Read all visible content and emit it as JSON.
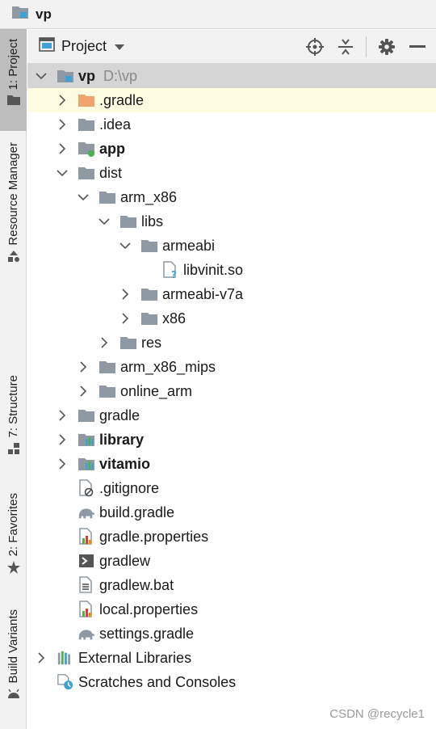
{
  "breadcrumb": {
    "title": "vp",
    "icon": "project-folder-icon"
  },
  "left_strip": {
    "tabs": [
      {
        "label": "1: Project",
        "icon": "folder-icon"
      },
      {
        "label": "Resource Manager",
        "icon": "shapes-icon"
      },
      {
        "label": "7: Structure",
        "icon": "structure-icon"
      },
      {
        "label": "2: Favorites",
        "icon": "star-icon"
      },
      {
        "label": "Build Variants",
        "icon": "android-icon"
      }
    ]
  },
  "panel_header": {
    "view_label": "Project",
    "tools": [
      "locate-icon",
      "collapse-all-icon",
      "gear-icon",
      "minimize-icon"
    ]
  },
  "tree": [
    {
      "label": "vp",
      "hint": "D:\\vp",
      "bold": true,
      "expanded": true,
      "icon": "module-folder-icon"
    },
    {
      "label": ".gradle",
      "icon": "orange-folder-icon",
      "expanded": false
    },
    {
      "label": ".idea",
      "icon": "folder-icon",
      "expanded": false
    },
    {
      "label": "app",
      "bold": true,
      "icon": "android-module-icon",
      "expanded": false
    },
    {
      "label": "dist",
      "icon": "folder-icon",
      "expanded": true
    },
    {
      "label": "arm_x86",
      "icon": "folder-icon",
      "expanded": true
    },
    {
      "label": "libs",
      "icon": "folder-icon",
      "expanded": true
    },
    {
      "label": "armeabi",
      "icon": "folder-icon",
      "expanded": true
    },
    {
      "label": "libvinit.so",
      "icon": "unknown-file-icon"
    },
    {
      "label": "armeabi-v7a",
      "icon": "folder-icon",
      "expanded": false
    },
    {
      "label": "x86",
      "icon": "folder-icon",
      "expanded": false
    },
    {
      "label": "res",
      "icon": "folder-icon",
      "expanded": false
    },
    {
      "label": "arm_x86_mips",
      "icon": "folder-icon",
      "expanded": false
    },
    {
      "label": "online_arm",
      "icon": "folder-icon",
      "expanded": false
    },
    {
      "label": "gradle",
      "icon": "folder-icon",
      "expanded": false
    },
    {
      "label": "library",
      "bold": true,
      "icon": "library-module-icon",
      "expanded": false
    },
    {
      "label": "vitamio",
      "bold": true,
      "icon": "library-module-icon",
      "expanded": false
    },
    {
      "label": ".gitignore",
      "icon": "gitignore-file-icon"
    },
    {
      "label": "build.gradle",
      "icon": "gradle-elephant-icon"
    },
    {
      "label": "gradle.properties",
      "icon": "properties-file-icon"
    },
    {
      "label": "gradlew",
      "icon": "shell-script-icon"
    },
    {
      "label": "gradlew.bat",
      "icon": "text-file-icon"
    },
    {
      "label": "local.properties",
      "icon": "properties-file-icon"
    },
    {
      "label": "settings.gradle",
      "icon": "gradle-elephant-icon"
    },
    {
      "label": "External Libraries",
      "icon": "external-libraries-icon",
      "expanded": false
    },
    {
      "label": "Scratches and Consoles",
      "icon": "scratches-icon"
    }
  ],
  "watermark": "CSDN @recycle1",
  "colors": {
    "selected_row": "#d5d5d5",
    "highlight_row": "#fdfbe0",
    "folder": "#8e99a3",
    "accent_blue": "#3ea2d6",
    "orange_folder": "#f0a36a"
  }
}
